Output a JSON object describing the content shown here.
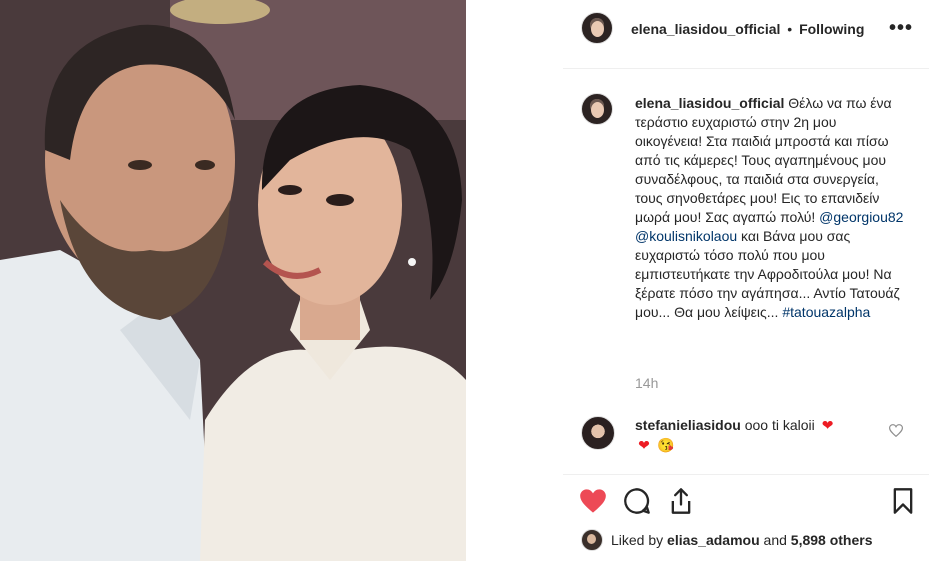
{
  "post": {
    "username": "elena_liasidou_official",
    "separator": "•",
    "follow_label": "Following",
    "more_label": "•••"
  },
  "caption": {
    "username": "elena_liasidou_official",
    "text": "Θέλω να πω ένα τεράστιο ευχαριστώ στην 2η μου οικογένεια! Στα παιδιά μπροστά και πίσω από τις κάμερες! Τους αγαπημένους μου συναδέλφους, τα παιδιά στα συνεργεία, τους σηνοθετάρες μου! Εις το επανιδείν μωρά μου! Σας αγαπώ πολύ!",
    "mention1": "@georgiou82",
    "mention2": "@koulisnikolaou",
    "text2": "και Βάνα μου σας ευχαριστώ τόσο πολύ που μου εμπιστευτήκατε την Αφροδιτούλα μου! Να ξέρατε πόσο την αγάπησα... Αντίο Τατουάζ μου... Θα μου λείψεις...",
    "hashtag": "#tatouazalpha",
    "time": "14h"
  },
  "comment": {
    "username": "stefanieliasidou",
    "text": "οοο ti kaloii",
    "emoji1": "❤",
    "emoji2": "❤",
    "emoji3": "😘",
    "like_icon": "heart-outline-icon"
  },
  "actions": {
    "like_icon": "heart-filled-icon",
    "comment_icon": "comment-icon",
    "share_icon": "share-icon",
    "save_icon": "bookmark-icon",
    "like_color": "#ed4956"
  },
  "likes": {
    "prefix": "Liked by",
    "user": "elias_adamou",
    "middle": "and",
    "count": "5,898 others"
  }
}
